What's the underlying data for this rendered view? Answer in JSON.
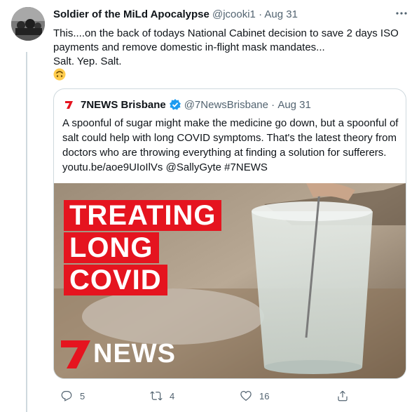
{
  "tweet": {
    "author_name": "Soldier of the MiLd Apocalypse",
    "handle": "@jcooki1",
    "separator": "·",
    "date": "Aug 31",
    "text": "This....on the back of todays National Cabinet decision to save 2 days ISO payments and remove  domestic in-flight mask mandates...",
    "text_line2": "Salt. Yep. Salt.",
    "emoji": "upside-down-face"
  },
  "quoted": {
    "author_name": "7NEWS Brisbane",
    "handle": "@7NewsBrisbane",
    "separator": "·",
    "date": "Aug 31",
    "text": "A spoonful of sugar might make the medicine go down, but a spoonful of salt could help with long COVID symptoms. That's the latest theory from doctors who are throwing everything at finding a solution for sufferers. youtu.be/aoe9UIoIlVs @SallyGyte #7NEWS",
    "media": {
      "title_lines": [
        "TREATING",
        "LONG",
        "COVID"
      ],
      "logo_numeral": "7",
      "logo_word": "NEWS"
    }
  },
  "actions": {
    "reply_count": "5",
    "retweet_count": "4",
    "like_count": "16"
  },
  "colors": {
    "muted": "#536471",
    "verified_blue": "#1d9bf0",
    "news_red": "#e5141f",
    "border": "#cfd9de"
  }
}
